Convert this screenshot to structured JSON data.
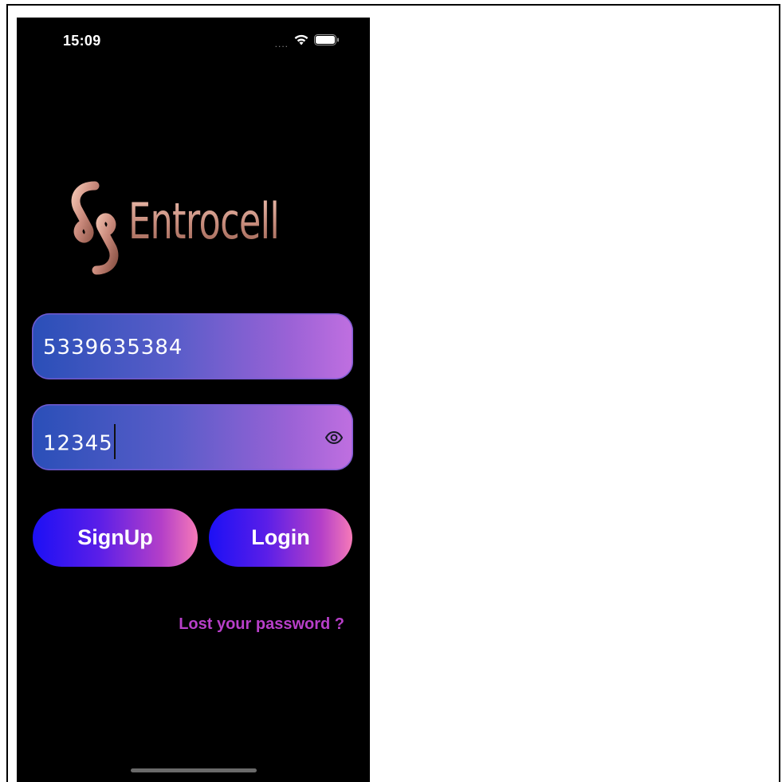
{
  "status_bar": {
    "time": "15:09",
    "signal": "....",
    "wifi_icon": "wifi-icon",
    "battery_icon": "battery-icon"
  },
  "logo": {
    "text": "Entrocell",
    "icon": "entrocell-logo-mark",
    "color": "#d29a8a"
  },
  "form": {
    "phone_value": "5339635384",
    "password_value": "12345",
    "password_toggle_icon": "eye-icon"
  },
  "actions": {
    "signup_label": "SignUp",
    "login_label": "Login",
    "lost_password_label": "Lost your password ?"
  },
  "colors": {
    "background": "#000000",
    "field_gradient_start": "#2a4fb8",
    "field_gradient_end": "#c06fe0",
    "button_gradient_start": "#1c10f5",
    "button_gradient_end": "#f67ab8",
    "link": "#b83fc9"
  }
}
